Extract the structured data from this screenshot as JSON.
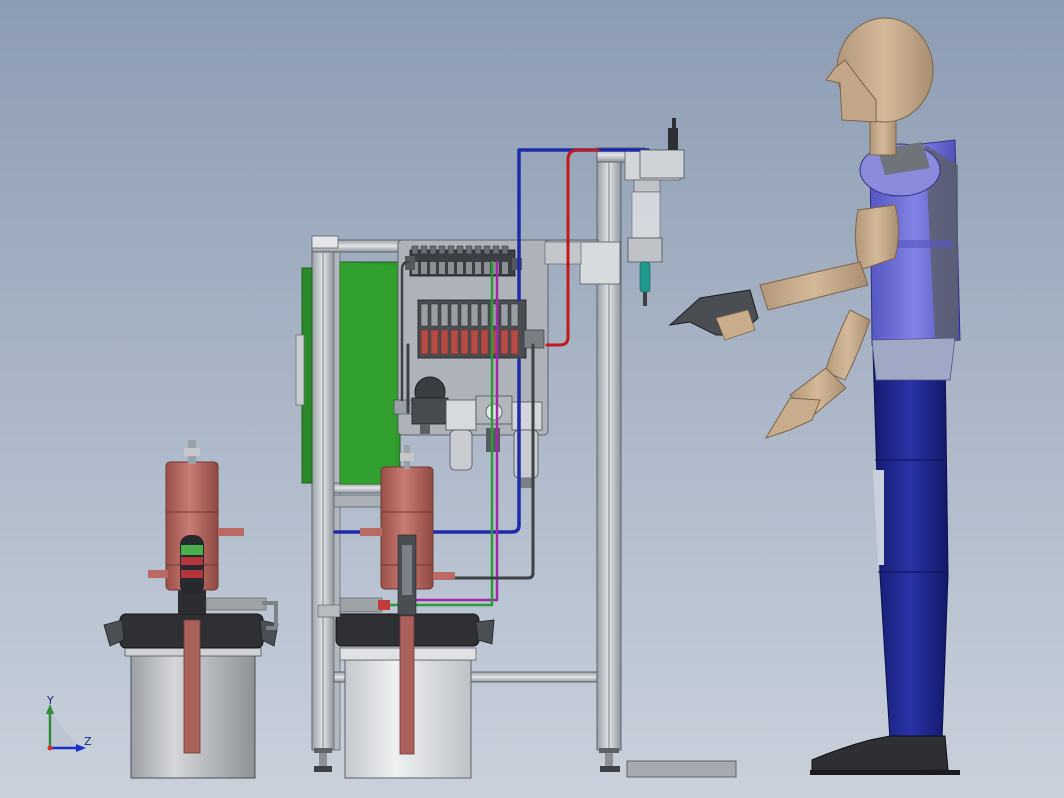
{
  "viewport": {
    "background_top": "#8c9cb3",
    "background_bottom": "#c9d1dc"
  },
  "axis_triad": {
    "y_label": "Y",
    "z_label": "Z",
    "y_color": "#2e8b3a",
    "z_color": "#1a2fc4",
    "origin_color": "#d32f2f"
  },
  "colors": {
    "frame": "#c7cbd1",
    "frame_dark": "#6f757c",
    "pump_red": "#b96a62",
    "tube_blue": "#1f2aa8",
    "tube_red": "#c21a1a",
    "tube_purple": "#a02aa6",
    "tube_green": "#2b9b3a",
    "panel_green": "#2f9a2c",
    "skin": "#c8ac8c",
    "shirt": "#6b6cd6",
    "pants": "#1c2388",
    "shoe": "#2d2d2d"
  }
}
